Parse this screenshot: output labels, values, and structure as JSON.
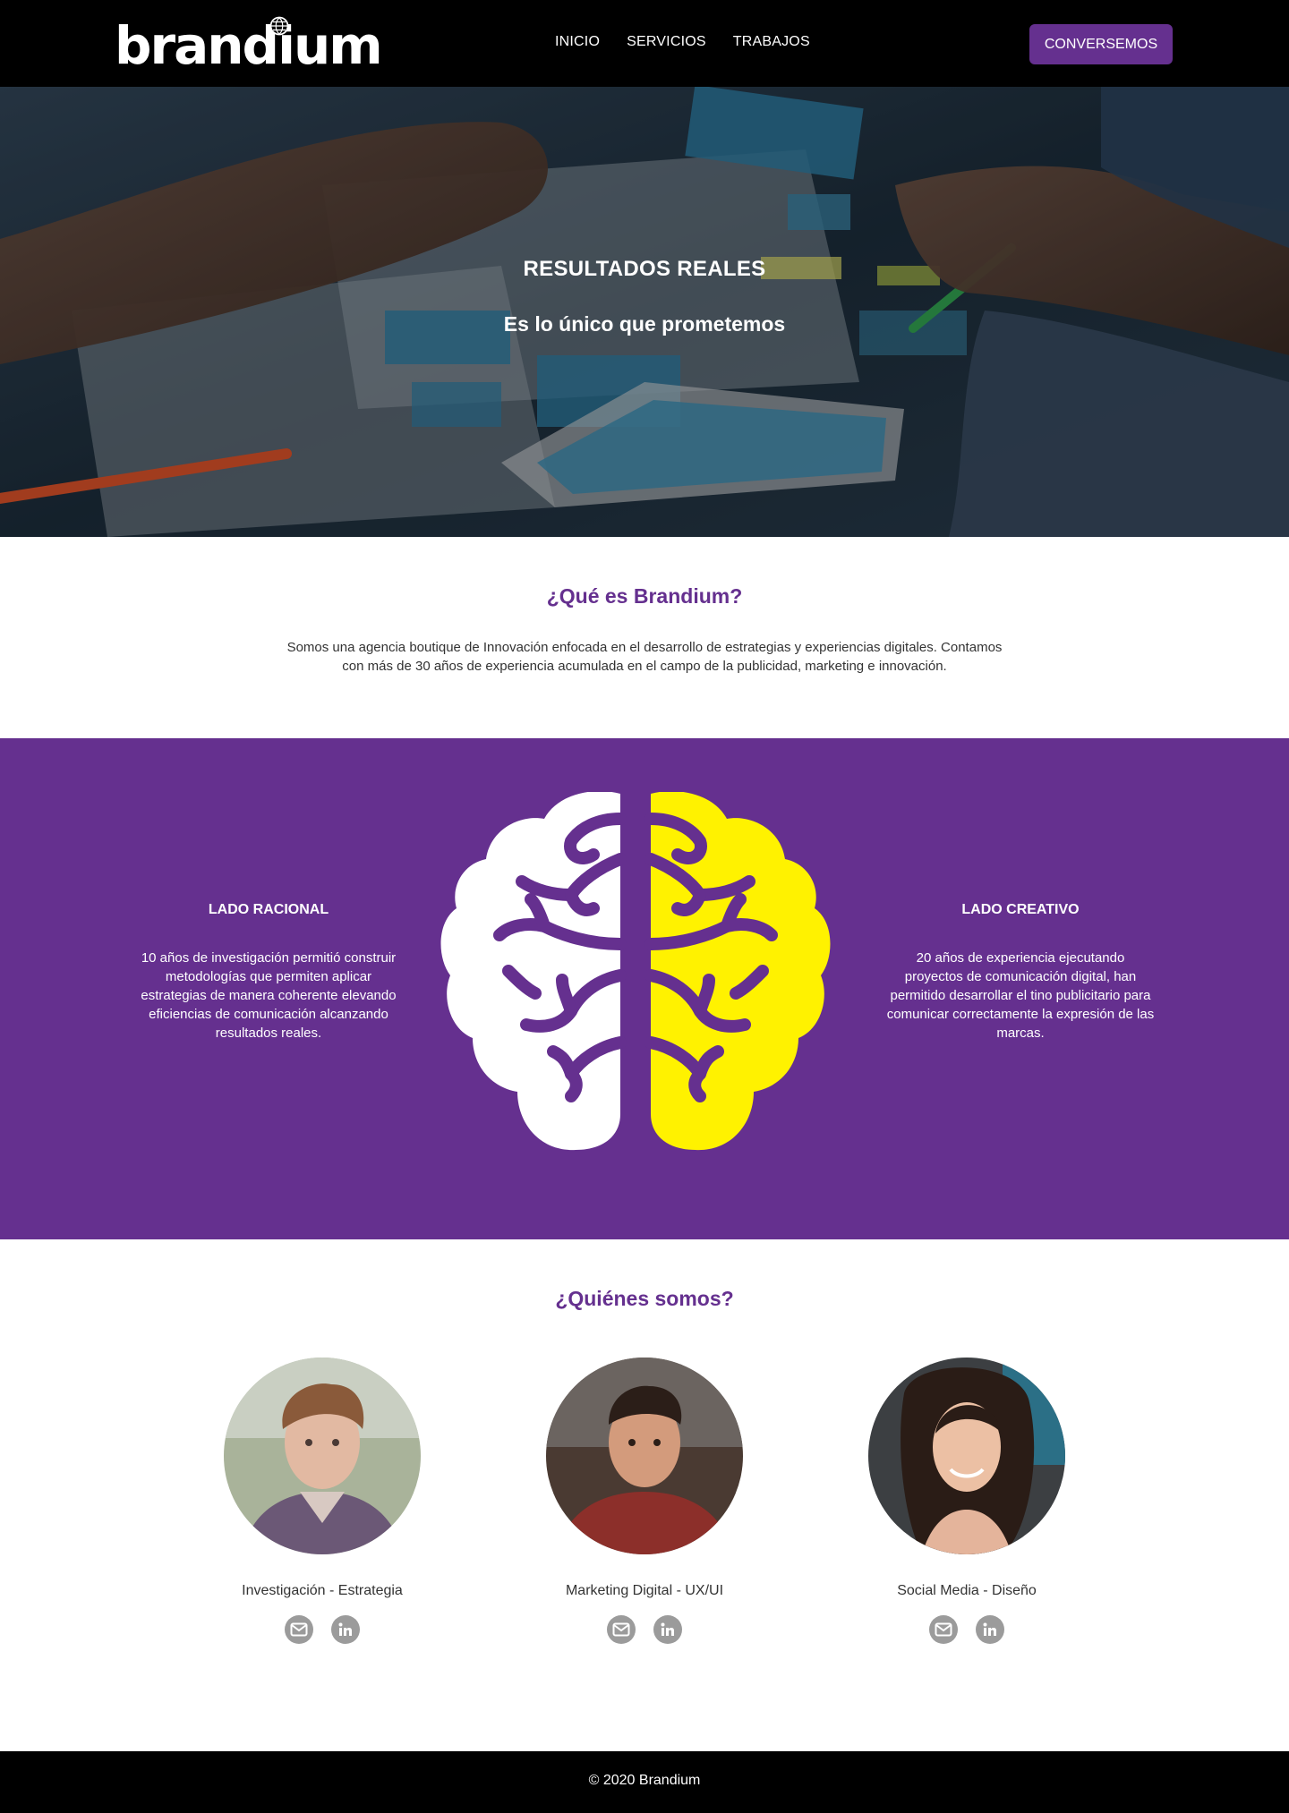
{
  "brand": {
    "logo_text": "brandium"
  },
  "nav": {
    "links": [
      "INICIO",
      "SERVICIOS",
      "TRABAJOS"
    ],
    "cta_label": "CONVERSEMOS"
  },
  "hero": {
    "title": "RESULTADOS REALES",
    "subtitle": "Es lo único que prometemos"
  },
  "about": {
    "title": "¿Qué es Brandium?",
    "text": "Somos una agencia boutique de Innovación enfocada en el desarrollo de estrategias y experiencias digitales. Contamos con más de 30 años de experiencia acumulada en el campo de la publicidad, marketing e innovación."
  },
  "brain": {
    "left_title": "LADO RACIONAL",
    "left_text": "10 años de investigación permitió construir metodologías  que permiten aplicar estrategias de manera coherente elevando eficiencias de comunicación alcanzando resultados reales.",
    "right_title": "LADO CREATIVO",
    "right_text": "20 años de experiencia ejecutando proyectos de comunicación digital, han permitido desarrollar el tino publicitario para comunicar correctamente la expresión de las marcas."
  },
  "team": {
    "title": "¿Quiénes somos?",
    "members": [
      {
        "role": "Investigación - Estrategia"
      },
      {
        "role": "Marketing Digital - UX/UI"
      },
      {
        "role": "Social Media - Diseño"
      }
    ]
  },
  "footer": {
    "text": "© 2020 Brandium"
  },
  "colors": {
    "accent": "#65308f",
    "yellow": "#fff200",
    "nav_bg": "#000000",
    "icon_gray": "#9b9b9b"
  }
}
